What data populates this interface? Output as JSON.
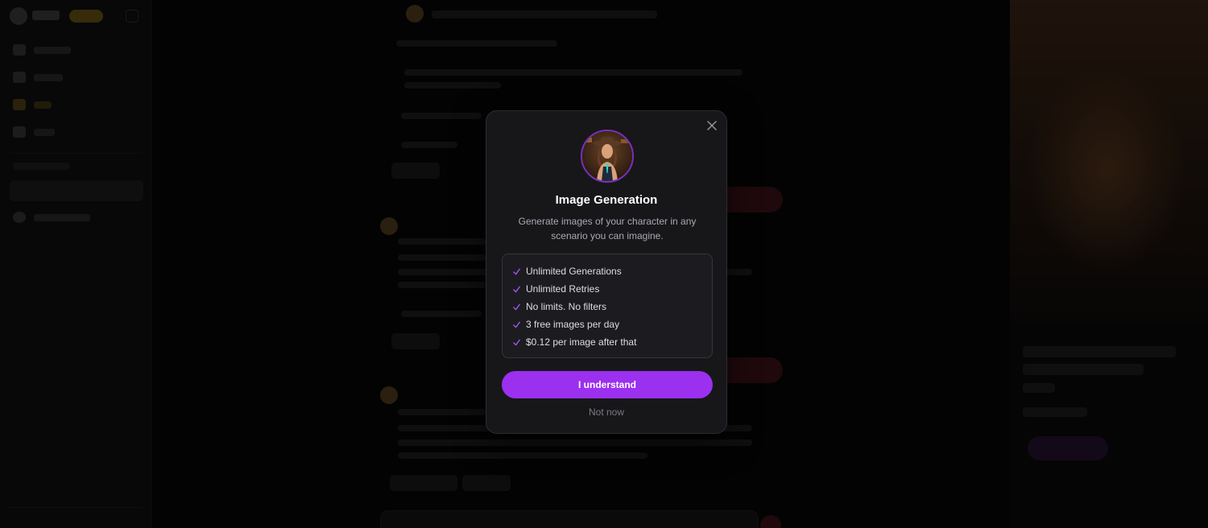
{
  "modal": {
    "title": "Image Generation",
    "description": "Generate images of your character in any scenario you can imagine.",
    "features": [
      "Unlimited Generations",
      "Unlimited Retries",
      "No limits. No filters",
      "3 free images per day",
      "$0.12 per image after that"
    ],
    "primary_button": "I understand",
    "secondary_button": "Not now",
    "close_icon": "close-icon",
    "check_icon": "check-icon"
  },
  "colors": {
    "accent": "#9b30ef",
    "check": "#a855f7",
    "modal_bg": "#17171a"
  }
}
